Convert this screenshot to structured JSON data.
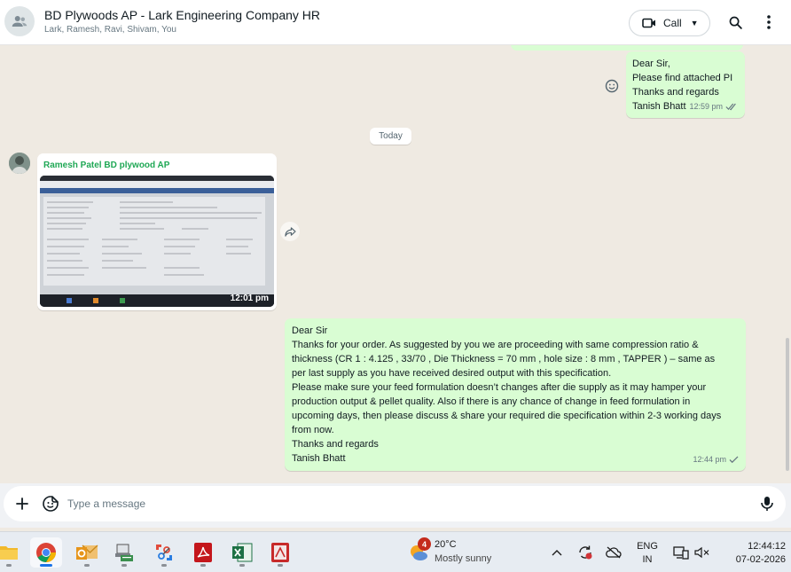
{
  "header": {
    "title": "BD Plywoods AP - Lark Engineering Company HR",
    "members": "Lark, Ramesh, Ravi, Shivam, You",
    "call_label": "Call"
  },
  "messages": [
    {
      "direction": "outgoing",
      "lines": [
        "Dear Sir,",
        "Please find attached PI",
        "Thanks and regards",
        "Tanish Bhatt"
      ],
      "time": "12:59 pm",
      "status": "read"
    },
    {
      "direction": "incoming",
      "sender": "Ramesh Patel BD plywood AP",
      "type": "image",
      "time": "12:01 pm"
    },
    {
      "direction": "outgoing",
      "lines": [
        "Dear Sir",
        "Thanks for your order. As suggested by you we are proceeding with same compression ratio &",
        "thickness (CR 1 : 4.125 , 33/70 , Die Thickness = 70 mm , hole size : 8 mm  , TAPPER ) – same as",
        "per last supply as you have received desired output with this specification.",
        "Please make sure your feed formulation doesn’t changes after die supply as it may hamper your",
        "production output & pellet quality. Also if there is any chance of change in feed formulation in",
        "upcoming days, then please discuss & share your required die specification within 2-3 working days",
        "from now.",
        "Thanks and regards",
        "Tanish Bhatt"
      ],
      "time": "12:44 pm",
      "status": "sent"
    }
  ],
  "date_divider": "Today",
  "composer": {
    "placeholder": "Type a message"
  },
  "taskbar": {
    "apps": [
      "file-explorer",
      "chrome",
      "outlook",
      "network-files",
      "snipping-tool",
      "acrobat-reader",
      "excel",
      "adobe-app"
    ],
    "active_app": "chrome",
    "weather": {
      "temp": "20°C",
      "condition": "Mostly sunny",
      "badge": "4"
    },
    "language": {
      "line1": "ENG",
      "line2": "IN"
    },
    "clock": {
      "time": "12:44:12",
      "date": "07-02-2026"
    }
  },
  "colors": {
    "outgoing_bubble": "#d9fdd3",
    "sender_name": "#1fa855",
    "read_tick": "#53bdeb",
    "chat_background": "#efeae2"
  }
}
